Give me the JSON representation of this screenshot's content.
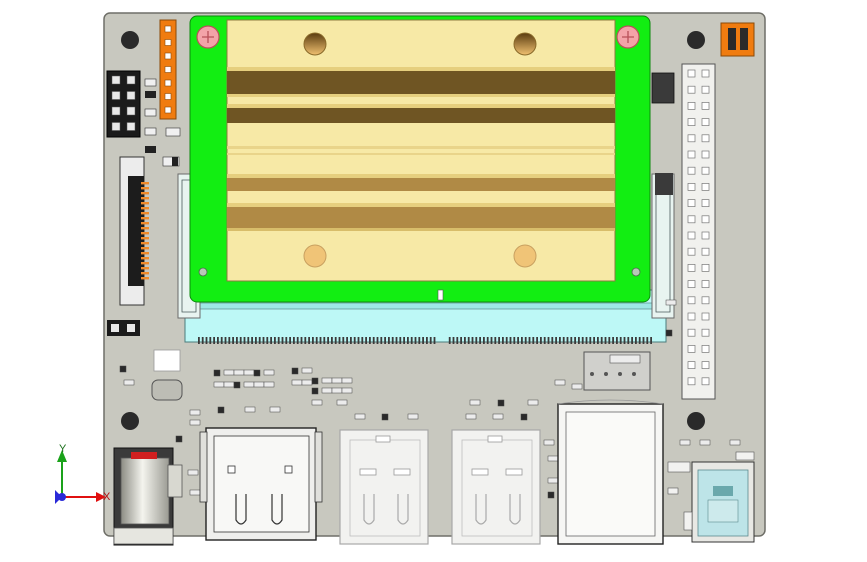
{
  "scene": {
    "title": "",
    "axes": {
      "x_label": "X",
      "y_label": "Y"
    }
  },
  "colors": {
    "background": "#ffffff",
    "pcb": "#c8c8bf",
    "pcb_edge": "#6f6f68",
    "module_green": "#12ee12",
    "module_gold": "#f7e9a6",
    "module_band_dark": "#6f5523",
    "module_band_mid": "#b08a45",
    "connector_cyan": "#bdf8f6",
    "header_orange": "#f07c10",
    "header_black": "#1b1b1b",
    "pin_header_white": "#f1f1ee",
    "usb_silver": "#d8d8d8",
    "axis_x_red": "#e01010",
    "axis_y_green": "#1aa21a",
    "axis_z_blue": "#2a2ad8"
  },
  "parts": [
    "pcb-board",
    "som-module",
    "sodimm-connector",
    "gpio-header-2x20",
    "orange-pin-header",
    "black-jumper-block",
    "fpc-connector",
    "dc-barrel-jack",
    "hdmi-connector",
    "usb-a-port-left",
    "usb-a-port-right",
    "rj45-jack",
    "usb-c-port"
  ]
}
